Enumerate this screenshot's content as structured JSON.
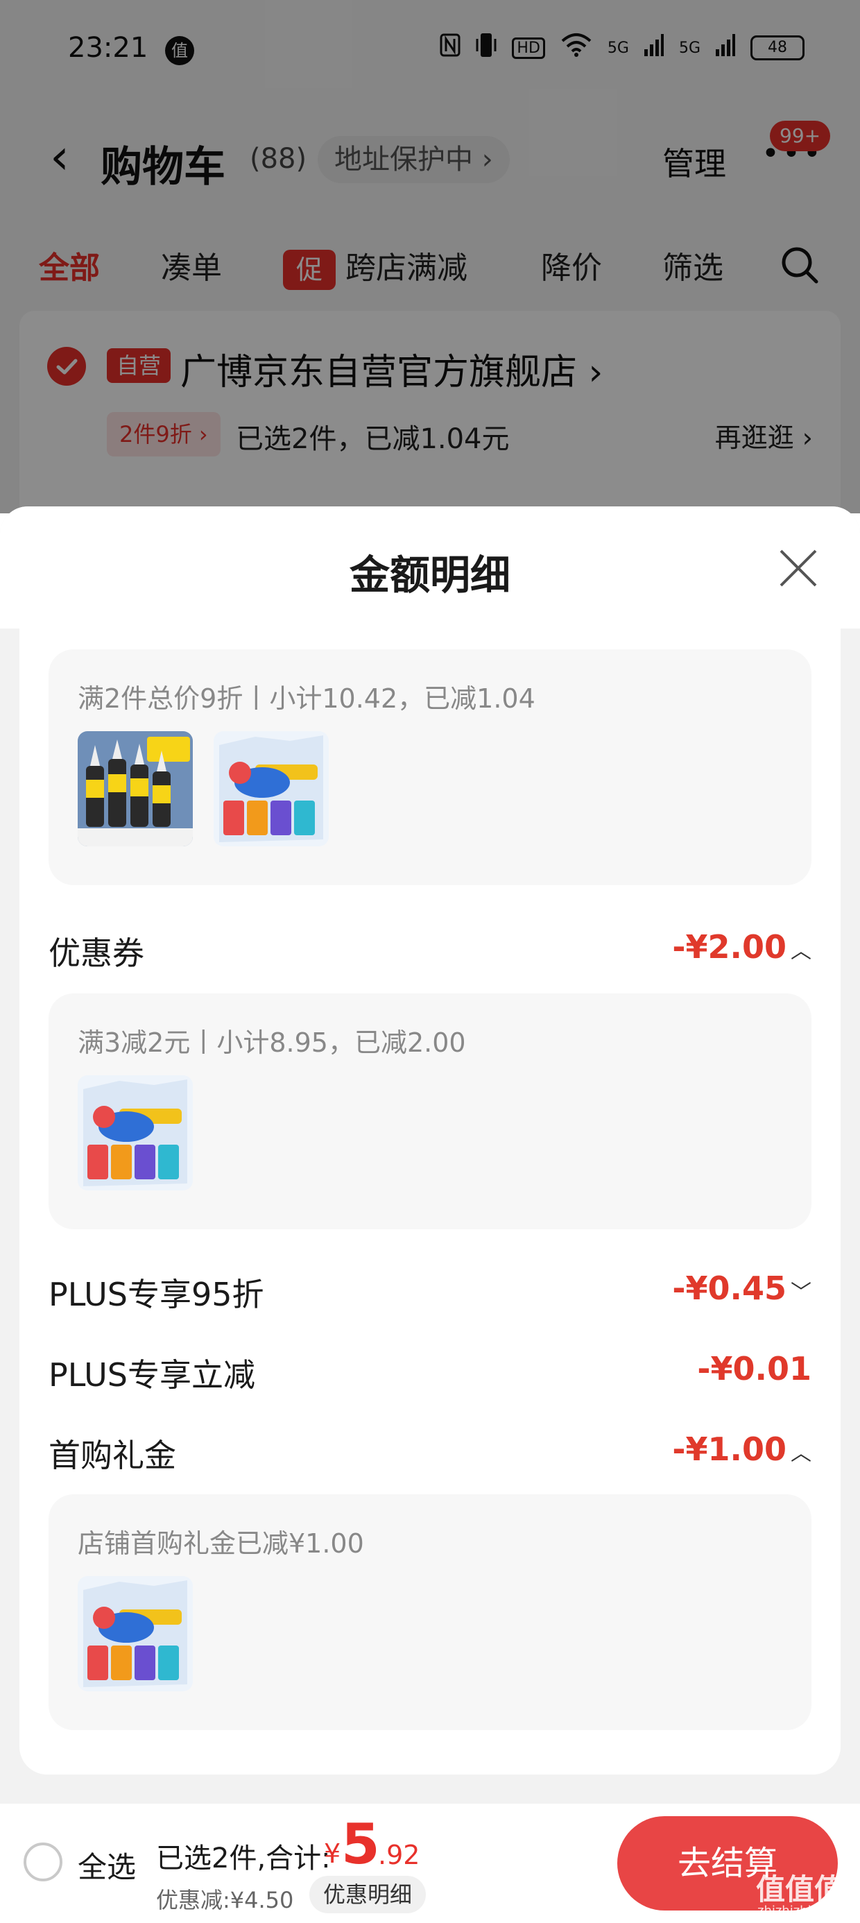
{
  "status_bar": {
    "time": "23:21",
    "app_badge": "值",
    "signal_1": "5G",
    "signal_2": "5G",
    "hd": "HD",
    "battery": "48"
  },
  "nav": {
    "title": "购物车",
    "count": "(88)",
    "address_protect": "地址保护中 ›",
    "manage": "管理",
    "message_badge": "99+"
  },
  "tabs": {
    "all": "全部",
    "bundle": "凑单",
    "promo_tag": "促",
    "cross_store": "跨店满减",
    "price_drop": "降价",
    "filter": "筛选"
  },
  "store": {
    "self_tag": "自营",
    "name": "广博京东自营官方旗舰店 ›",
    "deal_tag": "2件9折 ›",
    "deal_text": "已选2件，已减1.04元",
    "browse_more": "再逛逛 ›"
  },
  "sheet": {
    "title": "金额明细",
    "group_discount": {
      "caption": "满2件总价9折丨小计10.42，已减1.04"
    },
    "coupon": {
      "label": "优惠券",
      "value": "-¥2.00",
      "caption": "满3减2元丨小计8.95，已减2.00"
    },
    "plus_95": {
      "label": "PLUS专享95折",
      "value": "-¥0.45"
    },
    "plus_instant": {
      "label": "PLUS专享立减",
      "value": "-¥0.01"
    },
    "first_gift": {
      "label": "首购礼金",
      "value": "-¥1.00",
      "caption": "店铺首购礼金已减¥1.00"
    }
  },
  "bottom_bar": {
    "select_all": "全选",
    "total_label": "已选2件,合计:",
    "currency": "¥",
    "total_int": "5",
    "total_dec": ".92",
    "discount_label": "优惠减:¥4.50",
    "detail_button": "优惠明细",
    "checkout": "去结算"
  },
  "watermark": {
    "text": "值值值",
    "sub": "zhizhizhi.com"
  },
  "colors": {
    "accent": "#e8312b",
    "discount_red": "#e0392b",
    "checkout_button": "#e84545"
  }
}
